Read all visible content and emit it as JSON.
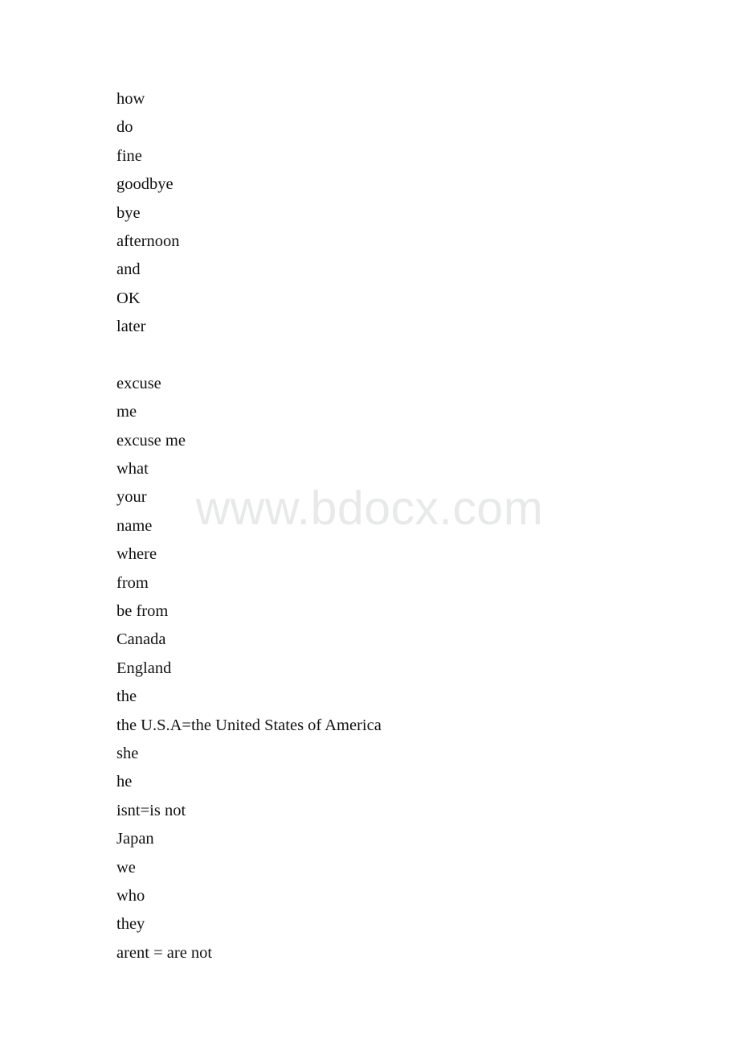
{
  "page": {
    "background_color": "#ffffff",
    "text_color": "#121212",
    "type": "document-page"
  },
  "watermark": {
    "text": "www.bdocx.com",
    "color": "#e8e9e9"
  },
  "document": {
    "lines": [
      {
        "text": "how"
      },
      {
        "text": "do"
      },
      {
        "text": "fine"
      },
      {
        "text": "goodbye"
      },
      {
        "text": "bye"
      },
      {
        "text": "afternoon"
      },
      {
        "text": "and"
      },
      {
        "text": "OK"
      },
      {
        "text": "later"
      },
      {
        "text": ""
      },
      {
        "text": "excuse"
      },
      {
        "text": "me"
      },
      {
        "text": "excuse me"
      },
      {
        "text": "what"
      },
      {
        "text": "your"
      },
      {
        "text": "name"
      },
      {
        "text": "where"
      },
      {
        "text": "from"
      },
      {
        "text": "be from"
      },
      {
        "text": "Canada"
      },
      {
        "text": "England"
      },
      {
        "text": "the"
      },
      {
        "text": "the U.S.A=the United States of America"
      },
      {
        "text": "she"
      },
      {
        "text": "he"
      },
      {
        "text": "isnt=is not"
      },
      {
        "text": "Japan"
      },
      {
        "text": "we"
      },
      {
        "text": "who"
      },
      {
        "text": "they"
      },
      {
        "text": "arent = are not"
      }
    ]
  }
}
